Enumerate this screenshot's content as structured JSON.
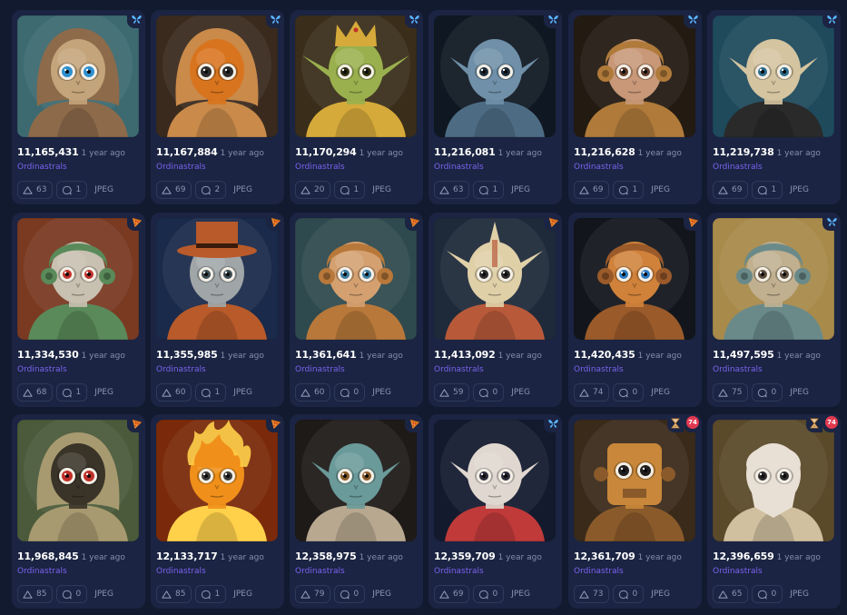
{
  "collection_default": "Ordinastrals",
  "colors": {
    "background": "#121a30",
    "card": "#1b2442",
    "accent": "#7b63f2",
    "butterfly": "#5ab4ff",
    "pizza": "#f08a2c",
    "badge_red": "#e23950"
  },
  "cards": [
    {
      "inscription": "11,165,431",
      "time": "1 year ago",
      "collection": "Ordinastrals",
      "upvotes": "63",
      "comments": "1",
      "format": "JPEG",
      "badge": "butterfly-icon",
      "pending": false,
      "pending_count": "",
      "palette": {
        "bg": "#3c6a70",
        "head": "#c4a47a",
        "eyes": "#2c8fd0",
        "accent": "#8c6a4a"
      },
      "hat": "hood"
    },
    {
      "inscription": "11,167,884",
      "time": "1 year ago",
      "collection": "Ordinastrals",
      "upvotes": "69",
      "comments": "2",
      "format": "JPEG",
      "badge": "butterfly-icon",
      "pending": false,
      "pending_count": "",
      "palette": {
        "bg": "#3a2a1e",
        "head": "#d9741e",
        "eyes": "#2b2b2b",
        "accent": "#c98a4a"
      },
      "hat": "hood"
    },
    {
      "inscription": "11,170,294",
      "time": "1 year ago",
      "collection": "Ordinastrals",
      "upvotes": "20",
      "comments": "1",
      "format": "JPEG",
      "badge": "butterfly-icon",
      "pending": false,
      "pending_count": "",
      "palette": {
        "bg": "#3a2e1a",
        "head": "#9ab04e",
        "eyes": "#2a2a10",
        "accent": "#d6aa3a"
      },
      "hat": "crown"
    },
    {
      "inscription": "11,216,081",
      "time": "1 year ago",
      "collection": "Ordinastrals",
      "upvotes": "63",
      "comments": "1",
      "format": "JPEG",
      "badge": "butterfly-icon",
      "pending": false,
      "pending_count": "",
      "palette": {
        "bg": "#0f1822",
        "head": "#6f90a8",
        "eyes": "#1c2c3a",
        "accent": "#4d6c84"
      },
      "hat": "none"
    },
    {
      "inscription": "11,216,628",
      "time": "1 year ago",
      "collection": "Ordinastrals",
      "upvotes": "69",
      "comments": "1",
      "format": "JPEG",
      "badge": "butterfly-icon",
      "pending": false,
      "pending_count": "",
      "palette": {
        "bg": "#231a12",
        "head": "#c89878",
        "eyes": "#5a3a2a",
        "accent": "#b07a3a"
      },
      "hat": "helmet"
    },
    {
      "inscription": "11,219,738",
      "time": "1 year ago",
      "collection": "Ordinastrals",
      "upvotes": "69",
      "comments": "1",
      "format": "JPEG",
      "badge": "butterfly-icon",
      "pending": false,
      "pending_count": "",
      "palette": {
        "bg": "#1e4a5c",
        "head": "#d4c4a0",
        "eyes": "#2a6a8a",
        "accent": "#2a2a2a"
      },
      "hat": "none"
    },
    {
      "inscription": "11,334,530",
      "time": "1 year ago",
      "collection": "Ordinastrals",
      "upvotes": "68",
      "comments": "1",
      "format": "JPEG",
      "badge": "pizza-icon",
      "pending": false,
      "pending_count": "",
      "palette": {
        "bg": "#7a3a22",
        "head": "#c8c0b0",
        "eyes": "#c0302a",
        "accent": "#5a8a5a"
      },
      "hat": "helmet"
    },
    {
      "inscription": "11,355,985",
      "time": "1 year ago",
      "collection": "Ordinastrals",
      "upvotes": "60",
      "comments": "1",
      "format": "JPEG",
      "badge": "pizza-icon",
      "pending": false,
      "pending_count": "",
      "palette": {
        "bg": "#1a2a4a",
        "head": "#a0a6a8",
        "eyes": "#3a4a50",
        "accent": "#b85a2a"
      },
      "hat": "tophat"
    },
    {
      "inscription": "11,361,641",
      "time": "1 year ago",
      "collection": "Ordinastrals",
      "upvotes": "60",
      "comments": "0",
      "format": "JPEG",
      "badge": "pizza-icon",
      "pending": false,
      "pending_count": "",
      "palette": {
        "bg": "#2e4a4e",
        "head": "#d4a070",
        "eyes": "#3a7aa0",
        "accent": "#b8783a"
      },
      "hat": "helmet"
    },
    {
      "inscription": "11,413,092",
      "time": "1 year ago",
      "collection": "Ordinastrals",
      "upvotes": "59",
      "comments": "0",
      "format": "JPEG",
      "badge": "pizza-icon",
      "pending": false,
      "pending_count": "",
      "palette": {
        "bg": "#1e2a3a",
        "head": "#e0d0a8",
        "eyes": "#2a2a2a",
        "accent": "#b85a3a"
      },
      "hat": "spikes"
    },
    {
      "inscription": "11,420,435",
      "time": "1 year ago",
      "collection": "Ordinastrals",
      "upvotes": "74",
      "comments": "0",
      "format": "JPEG",
      "badge": "pizza-icon",
      "pending": false,
      "pending_count": "",
      "palette": {
        "bg": "#12161c",
        "head": "#d0823a",
        "eyes": "#2a7ac0",
        "accent": "#9a5a2a"
      },
      "hat": "helmet"
    },
    {
      "inscription": "11,497,595",
      "time": "1 year ago",
      "collection": "Ordinastrals",
      "upvotes": "75",
      "comments": "0",
      "format": "JPEG",
      "badge": "butterfly-icon",
      "pending": false,
      "pending_count": "",
      "palette": {
        "bg": "#a88a4a",
        "head": "#c0b090",
        "eyes": "#5a4a3a",
        "accent": "#6a8a8a"
      },
      "hat": "helmet"
    },
    {
      "inscription": "11,968,845",
      "time": "1 year ago",
      "collection": "Ordinastrals",
      "upvotes": "85",
      "comments": "0",
      "format": "JPEG",
      "badge": "pizza-icon",
      "pending": false,
      "pending_count": "",
      "palette": {
        "bg": "#4a5a3a",
        "head": "#3a3428",
        "eyes": "#c0302a",
        "accent": "#a89a70"
      },
      "hat": "hood"
    },
    {
      "inscription": "12,133,717",
      "time": "1 year ago",
      "collection": "Ordinastrals",
      "upvotes": "85",
      "comments": "1",
      "format": "JPEG",
      "badge": "pizza-icon",
      "pending": false,
      "pending_count": "",
      "palette": {
        "bg": "#7a2a0a",
        "head": "#f0901a",
        "eyes": "#3a3a3a",
        "accent": "#ffd04a"
      },
      "hat": "flames"
    },
    {
      "inscription": "12,358,975",
      "time": "1 year ago",
      "collection": "Ordinastrals",
      "upvotes": "79",
      "comments": "0",
      "format": "JPEG",
      "badge": "pizza-icon",
      "pending": false,
      "pending_count": "",
      "palette": {
        "bg": "#1e1a18",
        "head": "#6a9a9a",
        "eyes": "#8a5a2a",
        "accent": "#b8a890"
      },
      "hat": "none"
    },
    {
      "inscription": "12,359,709",
      "time": "1 year ago",
      "collection": "Ordinastrals",
      "upvotes": "69",
      "comments": "0",
      "format": "JPEG",
      "badge": "butterfly-icon",
      "pending": false,
      "pending_count": "",
      "palette": {
        "bg": "#141a2e",
        "head": "#e0d8d0",
        "eyes": "#2a2a3a",
        "accent": "#c03a3a"
      },
      "hat": "none"
    },
    {
      "inscription": "12,361,709",
      "time": "1 year ago",
      "collection": "Ordinastrals",
      "upvotes": "73",
      "comments": "0",
      "format": "JPEG",
      "badge": "none",
      "pending": true,
      "pending_count": "74",
      "palette": {
        "bg": "#3a2a1a",
        "head": "#c8873a",
        "eyes": "#1e1e1e",
        "accent": "#8a5a2a"
      },
      "hat": "robot"
    },
    {
      "inscription": "12,396,659",
      "time": "1 year ago",
      "collection": "Ordinastrals",
      "upvotes": "65",
      "comments": "0",
      "format": "JPEG",
      "badge": "none",
      "pending": true,
      "pending_count": "74",
      "palette": {
        "bg": "#5a4a2a",
        "head": "#e8e0d4",
        "eyes": "#2a2a2a",
        "accent": "#d0c0a0"
      },
      "hat": "mask"
    }
  ]
}
